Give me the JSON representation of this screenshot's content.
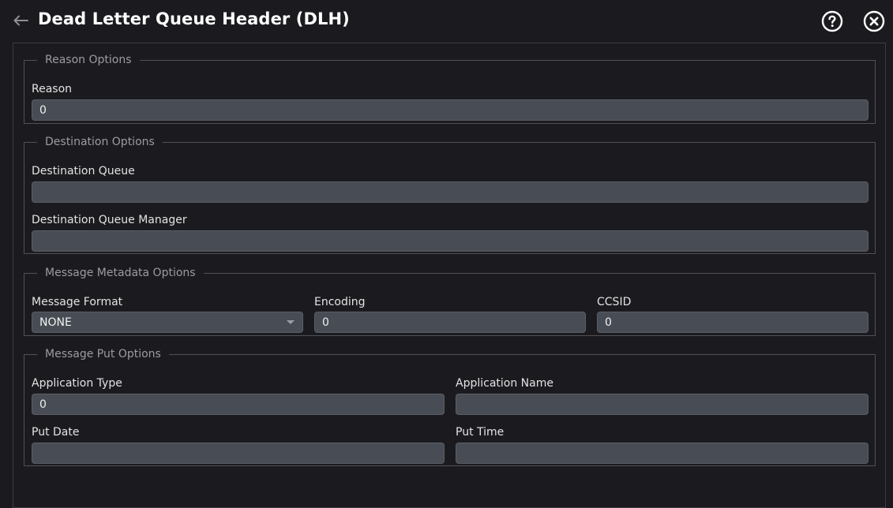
{
  "header": {
    "title": "Dead Letter Queue Header (DLH)"
  },
  "reason_options": {
    "legend": "Reason Options",
    "reason": {
      "label": "Reason",
      "value": "0"
    }
  },
  "destination_options": {
    "legend": "Destination Options",
    "destination_queue": {
      "label": "Destination Queue",
      "value": ""
    },
    "destination_queue_manager": {
      "label": "Destination Queue Manager",
      "value": ""
    }
  },
  "message_metadata_options": {
    "legend": "Message Metadata Options",
    "message_format": {
      "label": "Message Format",
      "value": "NONE"
    },
    "encoding": {
      "label": "Encoding",
      "value": "0"
    },
    "ccsid": {
      "label": "CCSID",
      "value": "0"
    }
  },
  "message_put_options": {
    "legend": "Message Put Options",
    "application_type": {
      "label": "Application Type",
      "value": "0"
    },
    "application_name": {
      "label": "Application Name",
      "value": ""
    },
    "put_date": {
      "label": "Put Date",
      "value": ""
    },
    "put_time": {
      "label": "Put Time",
      "value": ""
    }
  },
  "icons": {
    "back": "arrow-left-icon",
    "help": "question-circle-icon",
    "close": "close-circle-icon",
    "dropdown": "caret-down-icon"
  },
  "colors": {
    "background": "#1b1b1f",
    "input_fill": "#484c54",
    "border": "#505057",
    "legend_text": "#9b9ba3"
  }
}
